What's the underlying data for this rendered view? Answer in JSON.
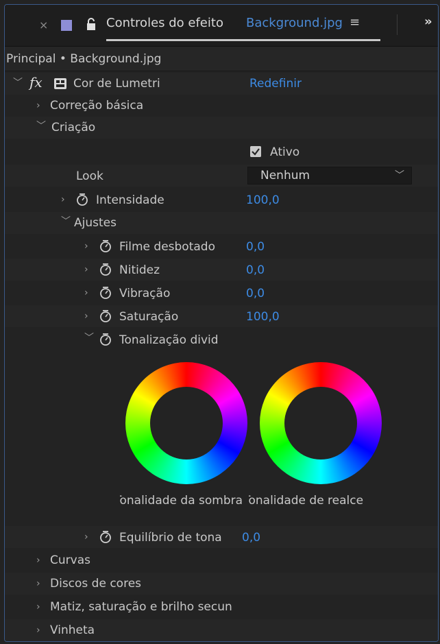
{
  "tab": {
    "close_glyph": "×",
    "title": "Controles do efeito",
    "source": "Background.jpg",
    "menu_glyph": "≡",
    "more_glyph": "»"
  },
  "breadcrumb": "Principal • Background.jpg",
  "effect": {
    "name": "Cor de Lumetri",
    "reset_label": "Redefinir",
    "fx_label": "fx"
  },
  "sections": {
    "basic": "Correção básica",
    "creative": "Criação",
    "curves": "Curvas",
    "color_wheels": "Discos de cores",
    "hsl_secondary": "Matiz, saturação e brilho secun",
    "vignette": "Vinheta"
  },
  "creative": {
    "active_label": "Ativo",
    "active_checked": true,
    "look_label": "Look",
    "look_value": "Nenhum",
    "intensity_label": "Intensidade",
    "intensity_value": "100,0",
    "adjustments_label": "Ajustes",
    "params": [
      {
        "label": "Filme desbotado",
        "value": "0,0"
      },
      {
        "label": "Nitidez",
        "value": "0,0"
      },
      {
        "label": "Vibração",
        "value": "0,0"
      },
      {
        "label": "Saturação",
        "value": "100,0"
      }
    ],
    "split_toning_label": "Tonalização divid",
    "shadow_tint_label": "Tonalidade da sombra",
    "highlight_tint_label": "Tonalidade de realce",
    "tint_balance_label": "Equilíbrio de tona",
    "tint_balance_value": "0,0"
  },
  "colors": {
    "accent": "#3d8be4",
    "background": "#232323"
  }
}
